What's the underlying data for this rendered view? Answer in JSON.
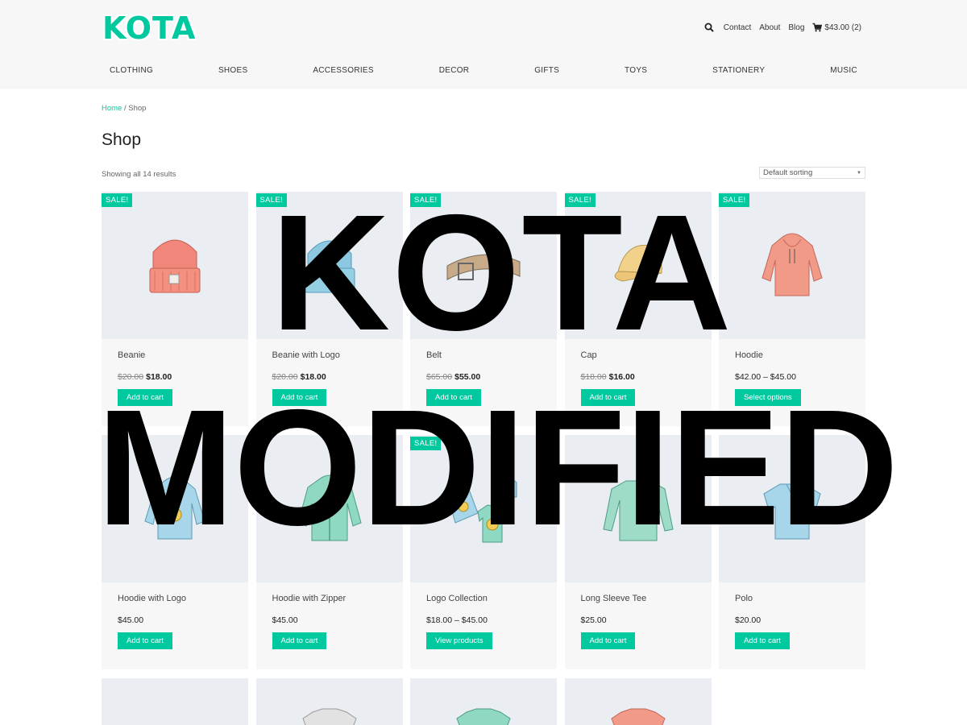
{
  "header": {
    "logo_text": "KOTA",
    "util_links": [
      "Contact",
      "About",
      "Blog"
    ],
    "cart_text": "$43.00 (2)",
    "icons": {
      "search": "search-icon",
      "cart": "cart-icon"
    },
    "accent_color": "#00c9a0"
  },
  "nav": {
    "items": [
      "CLOTHING",
      "SHOES",
      "ACCESSORIES",
      "DECOR",
      "GIFTS",
      "TOYS",
      "STATIONERY",
      "MUSIC"
    ]
  },
  "breadcrumb": {
    "home": "Home",
    "separator": " / ",
    "current": "Shop"
  },
  "page": {
    "title": "Shop",
    "result_count": "Showing all 14 results",
    "sort_value": "Default sorting"
  },
  "products": [
    {
      "name": "Beanie",
      "sale": "SALE!",
      "old_price": "$20.00",
      "price": "$18.00",
      "button": "Add to cart"
    },
    {
      "name": "Beanie with Logo",
      "sale": "SALE!",
      "old_price": "$20.00",
      "price": "$18.00",
      "button": "Add to cart"
    },
    {
      "name": "Belt",
      "sale": "SALE!",
      "old_price": "$65.00",
      "price": "$55.00",
      "button": "Add to cart"
    },
    {
      "name": "Cap",
      "sale": "SALE!",
      "old_price": "$18.00",
      "price": "$16.00",
      "button": "Add to cart"
    },
    {
      "name": "Hoodie",
      "sale": "SALE!",
      "old_price": "",
      "price": "$42.00 – $45.00",
      "button": "Select options"
    },
    {
      "name": "Hoodie with Logo",
      "sale": "",
      "old_price": "",
      "price": "$45.00",
      "button": "Add to cart"
    },
    {
      "name": "Hoodie with Zipper",
      "sale": "",
      "old_price": "",
      "price": "$45.00",
      "button": "Add to cart"
    },
    {
      "name": "Logo Collection",
      "sale": "SALE!",
      "old_price": "",
      "price": "$18.00 – $45.00",
      "button": "View products"
    },
    {
      "name": "Long Sleeve Tee",
      "sale": "",
      "old_price": "",
      "price": "$25.00",
      "button": "Add to cart"
    },
    {
      "name": "Polo",
      "sale": "",
      "old_price": "",
      "price": "$20.00",
      "button": "Add to cart"
    }
  ],
  "overlay": {
    "line1": "KOTA",
    "line2": "MODIFIED"
  }
}
